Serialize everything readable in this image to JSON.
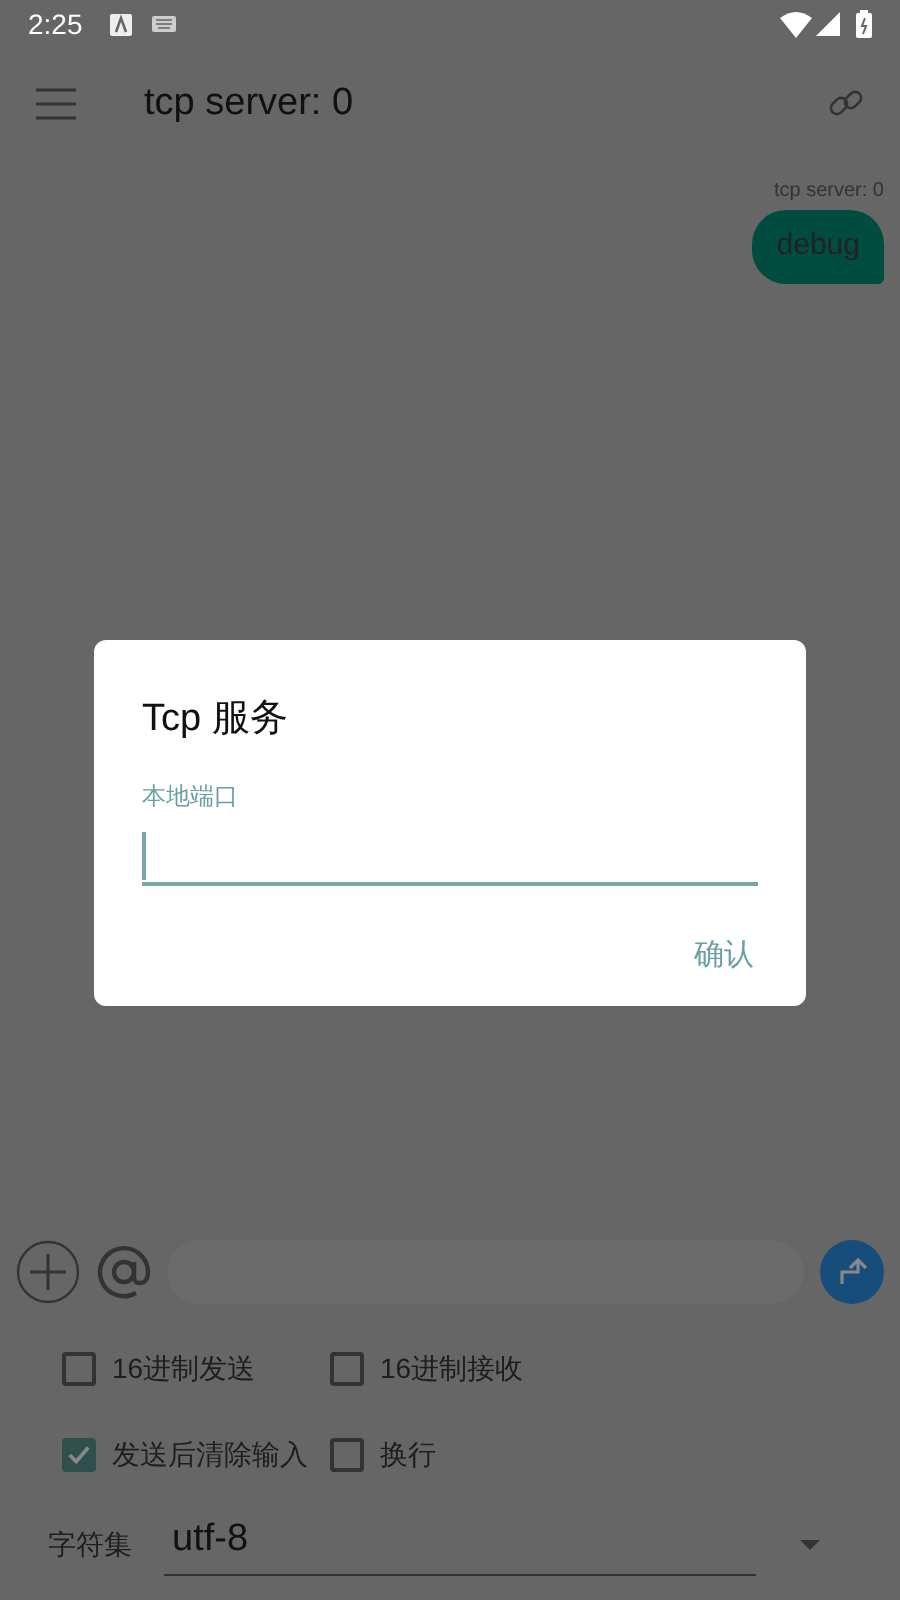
{
  "status_bar": {
    "time": "2:25"
  },
  "app_bar": {
    "title": "tcp server: 0"
  },
  "messages": [
    {
      "sender": "tcp server: 0",
      "text": "debug"
    }
  ],
  "options": [
    {
      "label": "16进制发送",
      "checked": false
    },
    {
      "label": "16进制接收",
      "checked": false
    },
    {
      "label": "发送后清除输入",
      "checked": true
    },
    {
      "label": "换行",
      "checked": false
    }
  ],
  "charset": {
    "label": "字符集",
    "value": "utf-8"
  },
  "dialog": {
    "title": "Tcp 服务",
    "field_label": "本地端口",
    "button": "确认"
  }
}
